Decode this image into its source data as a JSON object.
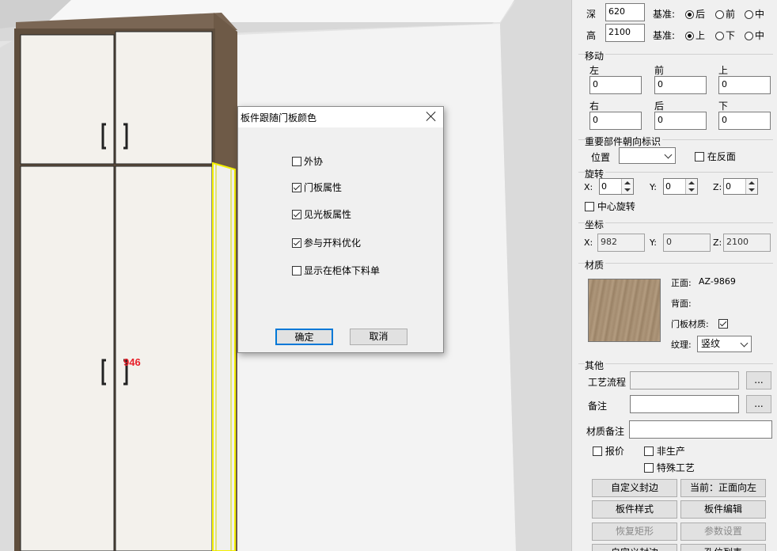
{
  "colors": {
    "panel_bg": "#f0f0f0",
    "selection": "#f4f000",
    "label_red": "#e8202a",
    "wood": "#a68e72"
  },
  "scene": {
    "dimension_label": "946"
  },
  "dialog": {
    "title": "板件跟随门板颜色",
    "checkboxes": [
      {
        "label": "外协",
        "checked": false
      },
      {
        "label": "门板属性",
        "checked": true
      },
      {
        "label": "见光板属性",
        "checked": true
      },
      {
        "label": "参与开料优化",
        "checked": true
      },
      {
        "label": "显示在柜体下料单",
        "checked": false
      }
    ],
    "ok": "确定",
    "cancel": "取消"
  },
  "panel": {
    "depth": {
      "label": "深",
      "value": "620",
      "base_label": "基准:",
      "options": [
        "后",
        "前",
        "中"
      ],
      "selected": "后"
    },
    "height": {
      "label": "高",
      "value": "2100",
      "base_label": "基准:",
      "options": [
        "上",
        "下",
        "中"
      ],
      "selected": "上"
    },
    "move": {
      "title": "移动",
      "labels": [
        "左",
        "前",
        "上",
        "右",
        "后",
        "下"
      ],
      "values": [
        "0",
        "0",
        "0",
        "0",
        "0",
        "0"
      ]
    },
    "orient": {
      "title": "重要部件朝向标识",
      "pos_label": "位置",
      "pos_value": "",
      "reverse_label": "在反面",
      "reverse_checked": false
    },
    "rotate": {
      "title": "旋转",
      "x_label": "X:",
      "y_label": "Y:",
      "z_label": "Z:",
      "x": "0",
      "y": "0",
      "z": "0",
      "center_label": "中心旋转",
      "center_checked": false
    },
    "coords": {
      "title": "坐标",
      "x_label": "X:",
      "y_label": "Y:",
      "z_label": "Z:",
      "x": "982",
      "y": "0",
      "z": "2100"
    },
    "material": {
      "title": "材质",
      "front_label": "正面:",
      "front_value": "AZ-9869",
      "back_label": "背面:",
      "back_value": "",
      "door_label": "门板材质:",
      "door_checked": true,
      "grain_label": "纹理:",
      "grain_value": "竖纹"
    },
    "other": {
      "title": "其他",
      "process_label": "工艺流程",
      "process_value": "",
      "note_label": "备注",
      "note_value": "",
      "matnote_label": "材质备注",
      "matnote_value": "",
      "ellipsis": "...",
      "quote_label": "报价",
      "quote_checked": false,
      "nonprod_label": "非生产",
      "nonprod_checked": false,
      "special_label": "特殊工艺",
      "special_checked": false
    },
    "buttons": {
      "custom_edge": "自定义封边",
      "current_dir": "当前：正面向左",
      "board_style": "板件样式",
      "board_edit": "板件编辑",
      "restore_rect": "恢复矩形",
      "param_set": "参数设置",
      "bottom_left": "自定义封边",
      "bottom_right": "孔位列表"
    }
  }
}
